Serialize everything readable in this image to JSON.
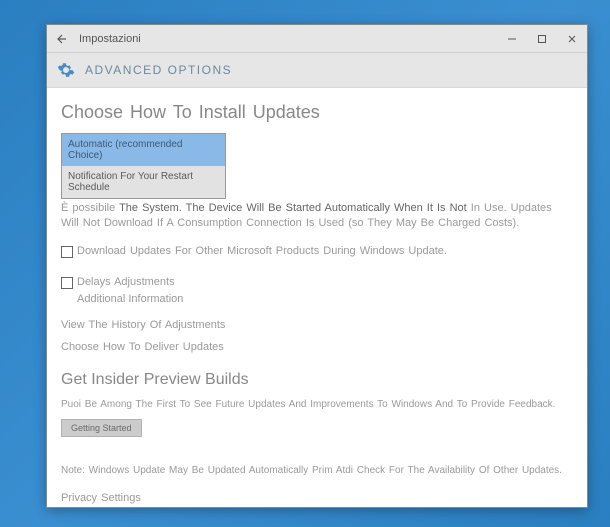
{
  "titlebar": {
    "back_icon": "←",
    "title": "Impostazioni",
    "min": "—",
    "max": "□",
    "close": "✕"
  },
  "header": {
    "title": "ADVANCED OPTIONS"
  },
  "section1": {
    "title": "Choose How To Install Updates",
    "dropdown": {
      "option1": "Automatic (recommended Choice)",
      "option2": "Notification For Your Restart Schedule"
    },
    "description_line1_dark": "The System. The Device Will Be Started Automatically When It Is Not",
    "description_line2": "In Use. Updates Will Not Download If A Consumption Connection Is Used (so They May Be Charged Costs).",
    "description_prefix": "È possibile"
  },
  "checkbox1": {
    "label": "Download Updates For Other Microsoft Products During Windows Update."
  },
  "checkbox2": {
    "label": "Delays Adjustments",
    "sublabel": "Additional Information"
  },
  "links": {
    "history": "View The History Of Adjustments",
    "delivery": "Choose How To Deliver Updates"
  },
  "insider": {
    "title": "Get Insider Preview Builds",
    "desc": "Puoi Be Among The First To See Future Updates And Improvements To Windows And To Provide Feedback.",
    "button": "Getting Started"
  },
  "note": "Note: Windows Update May Be Updated Automatically Prim Atdi Check For The Availability Of Other Updates.",
  "privacy": "Privacy Settings"
}
